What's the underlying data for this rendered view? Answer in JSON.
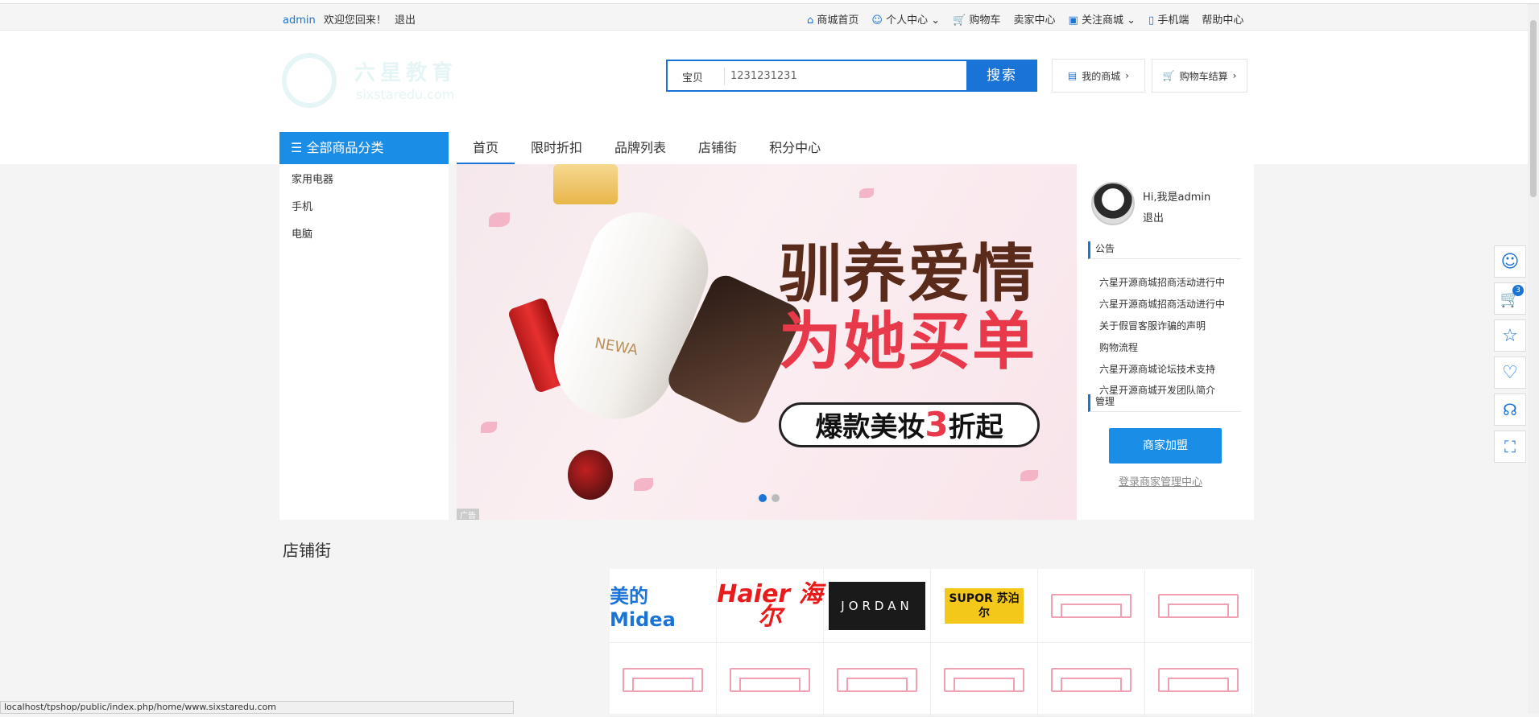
{
  "topbar": {
    "user": "admin",
    "welcome": "欢迎您回来！",
    "logout": "退出",
    "nav": [
      "商城首页",
      "个人中心",
      "购物车",
      "卖家中心",
      "关注商城",
      "手机端",
      "帮助中心"
    ]
  },
  "header": {
    "logo_text": "六星教育",
    "logo_sub": "sixstaredu.com",
    "search_type": "宝贝",
    "search_value": "1231231231",
    "search_button": "搜索",
    "my_shop": "我的商城",
    "cart_checkout": "购物车结算"
  },
  "category": {
    "title": "全部商品分类",
    "items": [
      "家用电器",
      "手机",
      "电脑"
    ]
  },
  "mainnav": [
    "首页",
    "限时折扣",
    "品牌列表",
    "店铺街",
    "积分中心"
  ],
  "banner": {
    "line1": "驯养爱情",
    "line2": "为她买单",
    "promo_a": "爆款美妆",
    "promo_num": "3",
    "promo_b": "折起",
    "product": "NEWA",
    "ad_tag": "广告"
  },
  "side": {
    "greeting": "Hi,我是admin",
    "logout": "退出",
    "notice_title": "公告",
    "notices": [
      "六星开源商城招商活动进行中",
      "六星开源商城招商活动进行中",
      "关于假冒客服诈骗的声明",
      "购物流程",
      "六星开源商城论坛技术支持",
      "六星开源商城开发团队简介"
    ],
    "manage_title": "管理",
    "join_button": "商家加盟",
    "login_link": "登录商家管理中心"
  },
  "shops": {
    "title": "店铺街",
    "brands": [
      "美的 Midea",
      "Haier 海尔",
      "JORDAN",
      "SUPOR 苏泊尔"
    ]
  },
  "rightbar": {
    "cart_count": "3"
  },
  "status_url": "localhost/tpshop/public/index.php/home/www.sixstaredu.com"
}
